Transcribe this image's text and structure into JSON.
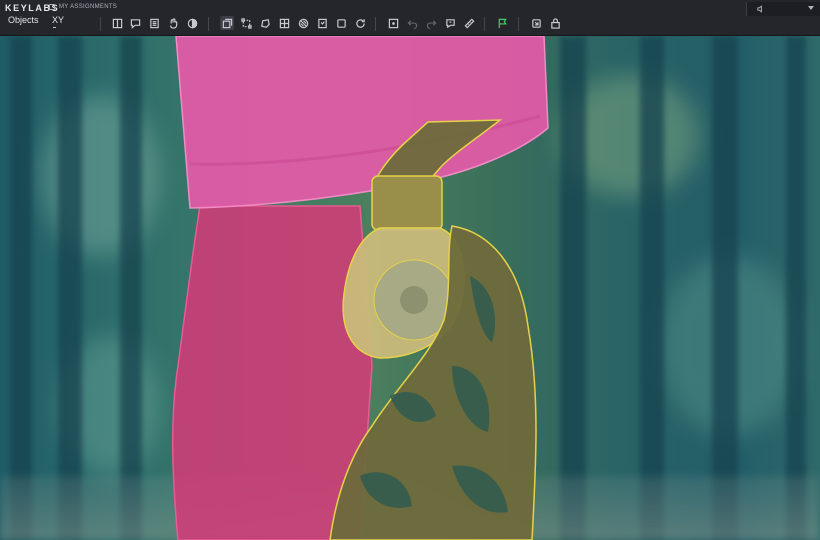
{
  "app": {
    "brand": "KEYLABS",
    "assignments_label": "MY ASSIGNMENTS"
  },
  "tabs": [
    {
      "label": "Objects"
    },
    {
      "label": "XY"
    }
  ],
  "toolbar": {
    "tools": [
      "new-object-icon",
      "comment-icon",
      "list-icon",
      "hand-icon",
      "contrast-icon",
      "copy-icon",
      "bounding-box-icon",
      "polygon-icon",
      "mask-icon",
      "texture-icon",
      "tag-icon",
      "square-icon",
      "rotate-icon",
      "crosshair-icon",
      "undo-icon",
      "redo-icon",
      "ai-icon",
      "ruler-icon",
      "flag-icon",
      "export-icon",
      "lock-icon"
    ]
  },
  "annotations": [
    {
      "label": "shorts",
      "color": "#e55aa8"
    },
    {
      "label": "leg",
      "color": "#d63a78"
    },
    {
      "label": "prosthesis",
      "color": "#e6d24a"
    }
  ]
}
